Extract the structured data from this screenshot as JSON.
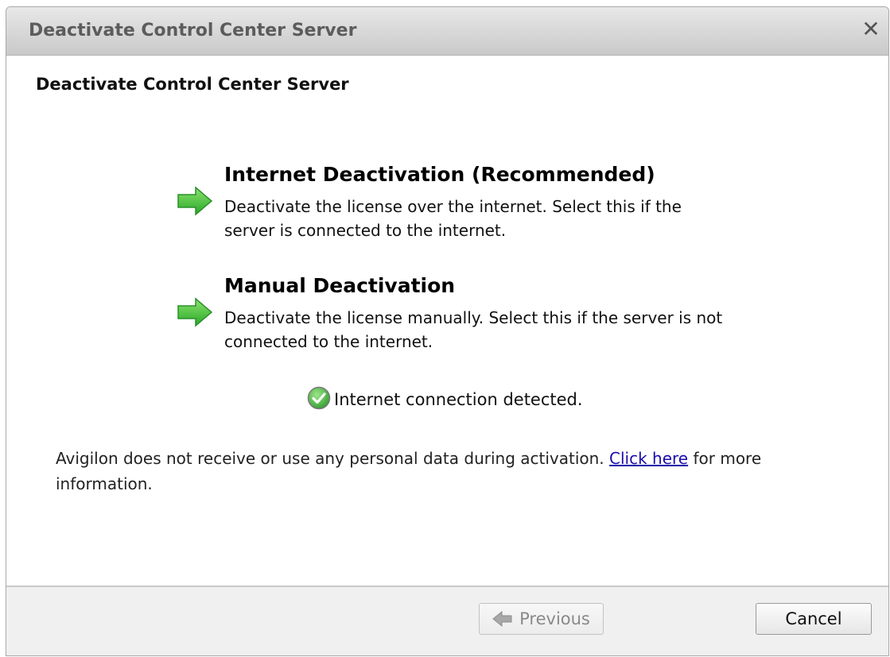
{
  "window": {
    "title": "Deactivate Control Center Server",
    "close_icon": "close-icon"
  },
  "page": {
    "heading": "Deactivate Control Center Server"
  },
  "options": [
    {
      "title": "Internet Deactivation (Recommended)",
      "description": "Deactivate the license over the internet.  Select this if the server is connected to the internet.",
      "icon": "green-arrow-icon"
    },
    {
      "title": "Manual Deactivation",
      "description": "Deactivate the license manually.  Select this if the server is not connected to the internet.",
      "icon": "green-arrow-icon"
    }
  ],
  "status": {
    "text": "Internet connection detected.",
    "icon": "green-check-icon"
  },
  "privacy": {
    "before": "Avigilon does not receive or use any personal data during activation. ",
    "link": "Click here",
    "after": " for more information."
  },
  "footer": {
    "previous_label": "Previous",
    "cancel_label": "Cancel"
  },
  "colors": {
    "arrow_green": "#3fbf3f",
    "link_blue": "#1a0dab"
  }
}
